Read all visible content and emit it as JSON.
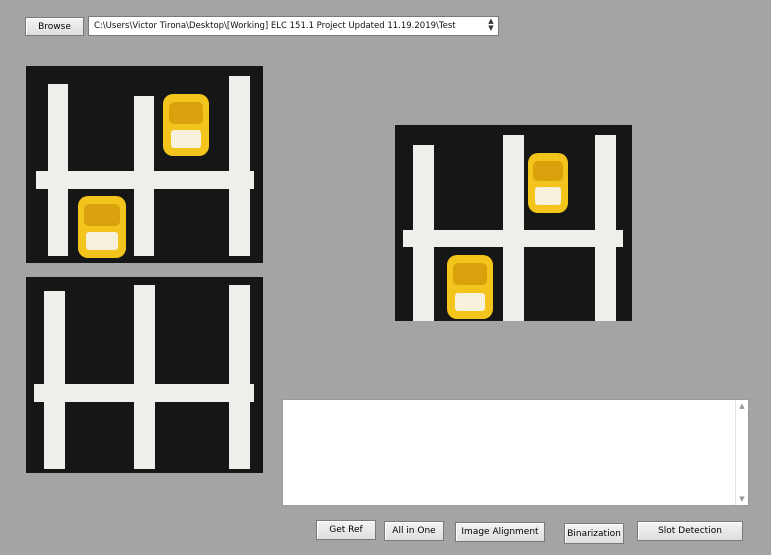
{
  "toolbar": {
    "browse_label": "Browse",
    "path_value": "C:\\Users\\Victor Tirona\\Desktop\\[Working] ELC 151.1 Project Updated 11.19.2019\\Test",
    "up_arrow": "▲",
    "down_arrow": "▼"
  },
  "images": {
    "top_left": {
      "icon": "parking-lot-photo-with-two-cars"
    },
    "bottom_left": {
      "icon": "empty-parking-lot-photo"
    },
    "right": {
      "icon": "parking-lot-photo-with-two-cars"
    }
  },
  "console": {
    "text": "",
    "up_arrow": "▲",
    "down_arrow": "▼"
  },
  "buttons": {
    "get_ref": "Get Ref",
    "all_in_one": "All in One",
    "image_alignment": "Image Alignment",
    "binarization": "Binarization",
    "slot_detection": "Slot Detection"
  },
  "colors": {
    "background": "#a4a4a4",
    "tape": "#efeeea",
    "car_yellow": "#f3c51c"
  }
}
